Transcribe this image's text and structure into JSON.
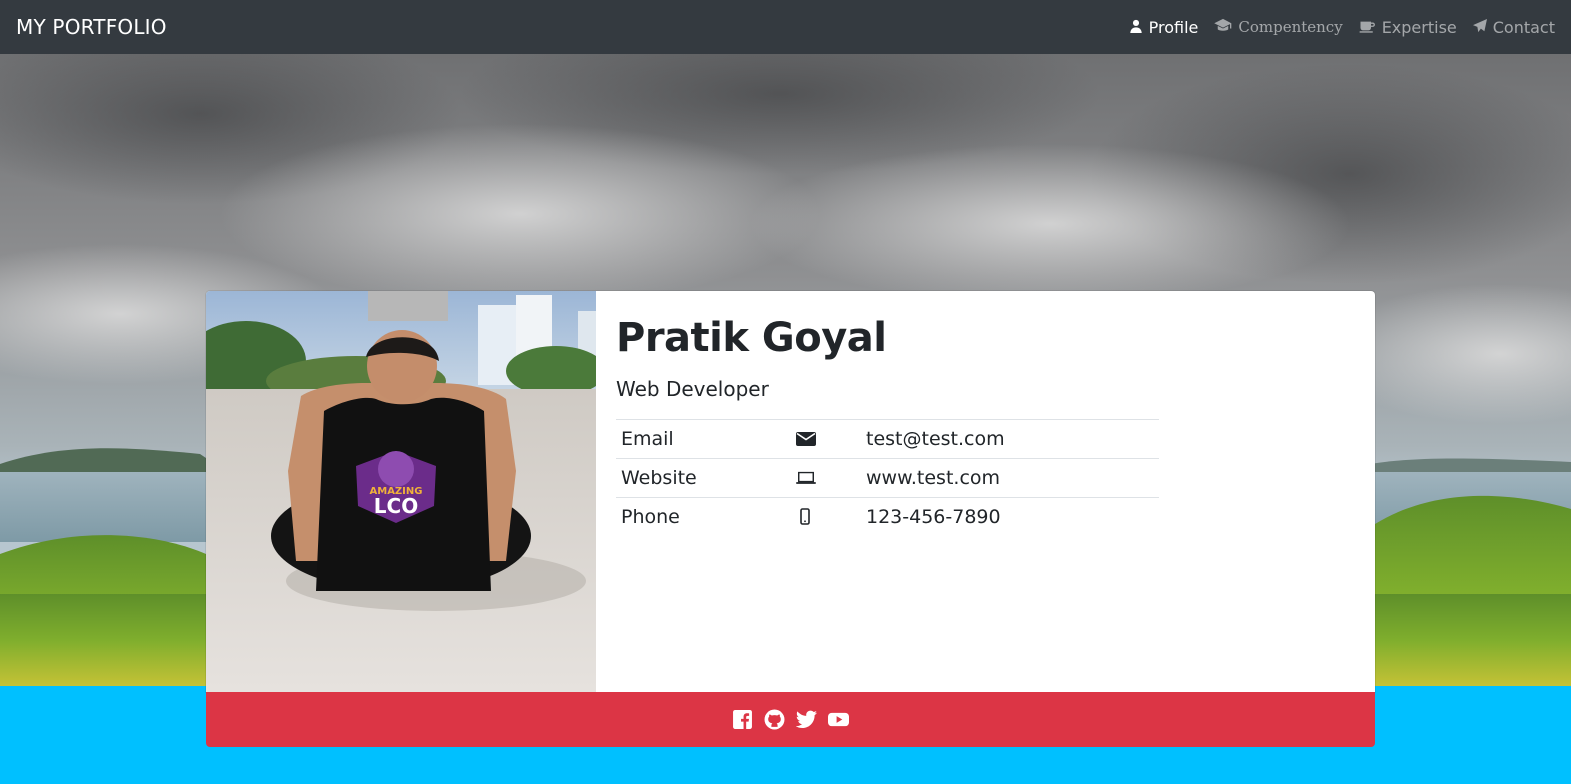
{
  "navbar": {
    "brand": "MY PORTFOLIO",
    "items": [
      {
        "label": "Profile",
        "icon": "user-icon",
        "active": true
      },
      {
        "label": "Compentency",
        "icon": "graduation-cap-icon",
        "active": false
      },
      {
        "label": "Expertise",
        "icon": "coffee-icon",
        "active": false
      },
      {
        "label": "Contact",
        "icon": "paper-plane-icon",
        "active": false
      }
    ]
  },
  "profile": {
    "name": "Pratik Goyal",
    "role": "Web Developer",
    "contacts": [
      {
        "label": "Email",
        "icon": "envelope-icon",
        "value": "test@test.com"
      },
      {
        "label": "Website",
        "icon": "laptop-icon",
        "value": "www.test.com"
      },
      {
        "label": "Phone",
        "icon": "mobile-icon",
        "value": "123-456-7890"
      }
    ],
    "photo_logo_text": [
      "AMAZING",
      "LCO"
    ]
  },
  "footer": {
    "social": [
      "facebook-icon",
      "github-icon",
      "twitter-icon",
      "youtube-icon"
    ]
  },
  "colors": {
    "navbar": "#343a40",
    "page_background": "#00c0ff",
    "footer": "#dc3545",
    "card": "#ffffff"
  }
}
